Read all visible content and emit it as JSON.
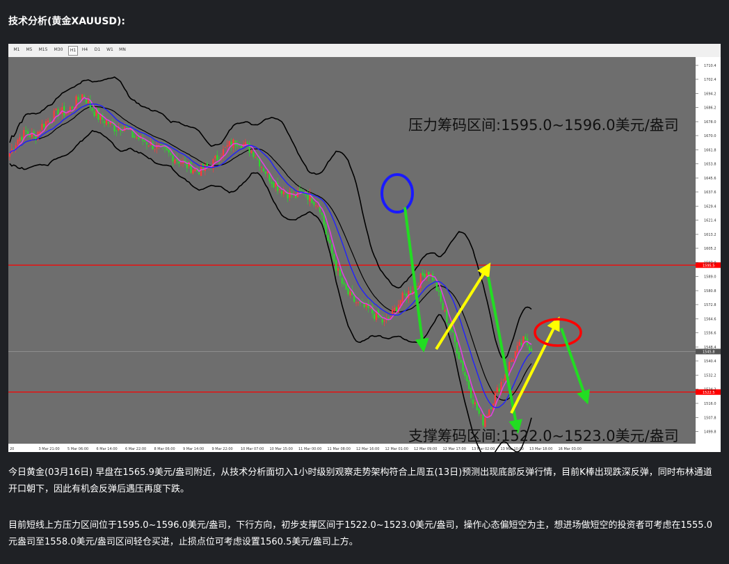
{
  "heading": "技术分析(黄金XAUUSD):",
  "timeframes": [
    "M1",
    "M5",
    "M15",
    "M30",
    "H1",
    "H4",
    "D1",
    "W1",
    "MN"
  ],
  "active_timeframe": "H1",
  "annotations": {
    "resistance": "压力筹码区间:1595.0~1596.0美元/盎司",
    "support": "支撑筹码区间:1522.0~1523.0美元/盎司"
  },
  "colors": {
    "chart_bg": "#6e6e6e",
    "up_candle": "#ff3b3b",
    "down_candle": "#2bdc2b",
    "ma_fast": "#e040e0",
    "ma_slow": "#2020ff",
    "bollinger": "#000000",
    "level_line": "#ff0000",
    "arrow_up": "#ffff00",
    "arrow_down": "#22dd22",
    "circle_blue": "#1a1aff",
    "circle_red": "#ff0000"
  },
  "chart_data": {
    "type": "candlestick",
    "symbol": "XAUUSD",
    "timeframe": "H1",
    "ylim": [
      1496,
      1712
    ],
    "yticks": [
      1710.4,
      1702.4,
      1694.2,
      1686.2,
      1678.0,
      1670.0,
      1661.8,
      1653.8,
      1645.6,
      1637.6,
      1629.4,
      1621.4,
      1613.2,
      1605.2,
      1597.0,
      1589.0,
      1580.8,
      1572.8,
      1564.6,
      1556.6,
      1548.4,
      1540.4,
      1532.2,
      1524.2,
      1516.0,
      1507.8,
      1499.8
    ],
    "xticks": [
      "20",
      "3 Mar 21:00",
      "5 Mar 06:00",
      "6 Mar 14:00",
      "6 Mar 22:00",
      "8 Mar 06:00",
      "9 Mar 14:00",
      "9 Mar 22:00",
      "10 Mar 07:00",
      "10 Mar 15:00",
      "11 Mar 00:00",
      "11 Mar 08:00",
      "12 Mar 16:00",
      "12 Mar 01:00",
      "12 Mar 09:00",
      "12 Mar 17:00",
      "13 Mar 02:00",
      "13 Mar 10:00",
      "13 Mar 18:00",
      "16 Mar 03:00"
    ],
    "horizontal_levels": [
      {
        "value": 1595.5,
        "label": "1595.5"
      },
      {
        "value": 1545.8,
        "label": "1545.8"
      },
      {
        "value": 1522.5,
        "label": "1522.5"
      }
    ],
    "path": [
      1660,
      1668,
      1672,
      1669,
      1676,
      1680,
      1684,
      1683,
      1689,
      1694,
      1686,
      1680,
      1678,
      1674,
      1676,
      1670,
      1668,
      1666,
      1663,
      1661,
      1658,
      1655,
      1652,
      1650,
      1651,
      1655,
      1660,
      1665,
      1667,
      1664,
      1660,
      1652,
      1645,
      1640,
      1637,
      1635,
      1638,
      1634,
      1630,
      1610,
      1595,
      1582,
      1576,
      1572,
      1570,
      1566,
      1562,
      1568,
      1576,
      1580,
      1585,
      1592,
      1588,
      1572,
      1560,
      1545,
      1530,
      1516,
      1505,
      1515,
      1525,
      1536,
      1545,
      1552,
      1548
    ]
  },
  "paragraphs": [
    "今日黄金(03月16日) 早盘在1565.9美元/盎司附近，从技术分析面切入1小时级别观察走势架构符合上周五(13日)预测出现底部反弹行情，目前K棒出现跌深反弹，同时布林通道开口朝下，因此有机会反弹后遇压再度下跌。",
    "目前短线上方压力区间位于1595.0~1596.0美元/盎司，下行方向，初步支撑区间于1522.0~1523.0美元/盎司，操作心态偏短空为主，想进场做短空的投资者可考虑在1555.0元盎司至1558.0美元/盎司区间轻仓买进，止损点位可考虑设置1560.5美元/盎司上方。"
  ]
}
